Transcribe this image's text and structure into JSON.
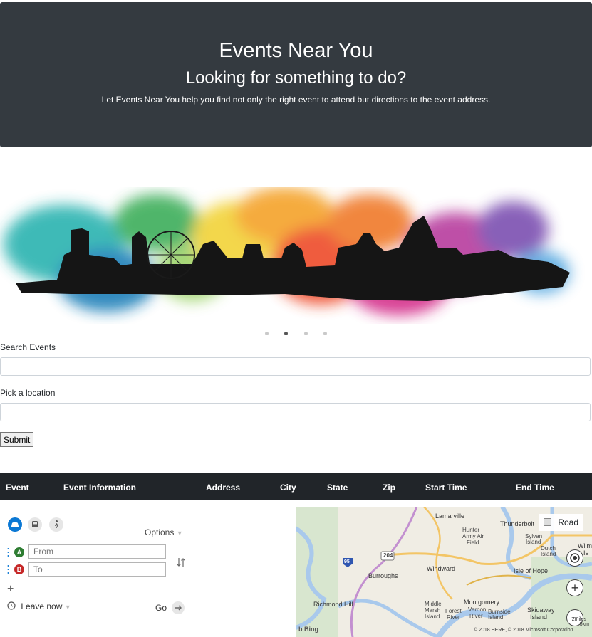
{
  "hero": {
    "title": "Events Near You",
    "subtitle": "Looking for something to do?",
    "description": "Let Events Near You help you find not only the right event to attend but directions to the event address."
  },
  "carousel": {
    "indicator_count": 4,
    "active_index": 1
  },
  "search": {
    "events_label": "Search Events",
    "events_value": "",
    "location_label": "Pick a location",
    "location_value": "",
    "submit_label": "Submit"
  },
  "table": {
    "headers": [
      "Event",
      "Event Information",
      "Address",
      "City",
      "State",
      "Zip",
      "Start Time",
      "End Time"
    ]
  },
  "directions": {
    "modes": [
      "car-icon",
      "bus-icon",
      "walk-icon"
    ],
    "active_mode": "car-icon",
    "options_label": "Options",
    "from_badge": "A",
    "to_badge": "B",
    "from_placeholder": "From",
    "to_placeholder": "To",
    "leave_label": "Leave now",
    "go_label": "Go",
    "colors": {
      "active_mode": "#0b78d4",
      "from_pin": "#2e7d32",
      "to_pin": "#c62828"
    }
  },
  "map": {
    "view_label": "Road",
    "labels": {
      "lamarville": "Lamarville",
      "hunter": "Hunter",
      "army_air": "Army Air",
      "field": "Field",
      "thunderbolt": "Thunderbolt",
      "sylvan": "Sylvan",
      "sylvan_island": "Island",
      "dutch": "Dutch",
      "dutch_island": "Island",
      "wilm": "Wilm",
      "wilm_is": "Is",
      "windward": "Windward",
      "isle_of_hope": "Isle of Hope",
      "burroughs": "Burroughs",
      "richmond_hill": "Richmond Hill",
      "montgomery": "Montgomery",
      "middle": "Middle",
      "marsh": "Marsh",
      "middle_island": "Island",
      "forest": "Forest",
      "forest_river": "River",
      "vernon": "Vernon",
      "vernon_river": "River",
      "burnside": "Burnside",
      "burnside_island": "Island",
      "skidaway": "Skidaway",
      "skidaway_island": "Island",
      "route_204": "204",
      "route_95": "95"
    },
    "attribution": "© 2018 HERE, © 2018 Microsoft Corporation",
    "scale_miles": "2miles",
    "scale_km": "5km",
    "brand": "Bing"
  }
}
